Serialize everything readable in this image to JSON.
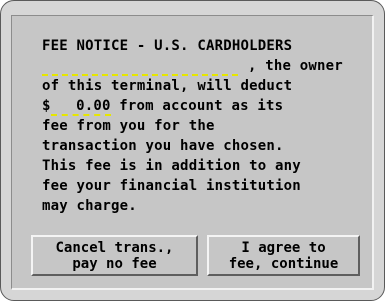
{
  "notice": {
    "title": "FEE NOTICE - U.S. CARDHOLDERS",
    "owner_suffix": ", the owner",
    "line3": "of this terminal, will deduct",
    "currency": "$",
    "amount": "0.00",
    "amount_suffix": " from account as its",
    "line5": "fee from you for the",
    "line6": "transaction you have chosen.",
    "line7": "This fee is in addition to any",
    "line8": "fee your financial institution",
    "line9": "may charge."
  },
  "buttons": {
    "cancel_label": "Cancel trans.,\npay no fee",
    "agree_label": "I agree to\nfee, continue"
  },
  "colors": {
    "blank_underline": "#e6e600",
    "screen_bg": "#c6c6c6"
  }
}
